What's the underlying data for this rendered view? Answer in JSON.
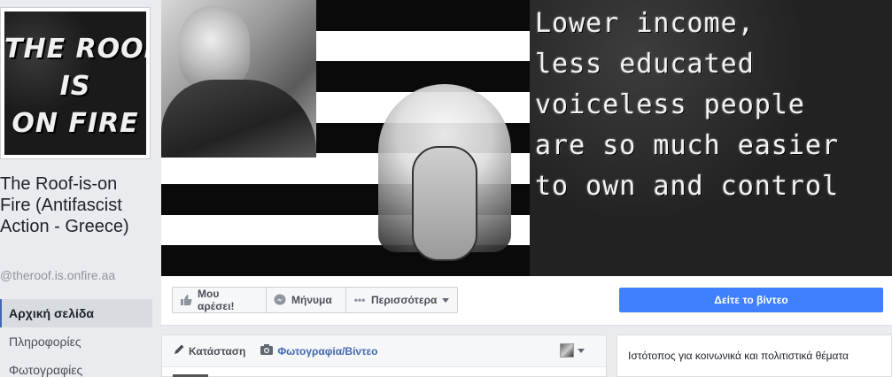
{
  "page": {
    "name": "The Roof-is-on Fire (Antifascist Action - Greece)",
    "handle": "@theroof.is.onfire.aa",
    "profile_logo_text": "THE ROOF\nIS\nON FIRE"
  },
  "nav": {
    "items": [
      {
        "label": "Αρχική σελίδα",
        "active": true
      },
      {
        "label": "Πληροφορίες",
        "active": false
      },
      {
        "label": "Φωτογραφίες",
        "active": false
      }
    ]
  },
  "cover": {
    "quote": "Lower income,\nless educated\nvoiceless people\nare so much easier\nto own and control",
    "flag_colors": [
      "#ffffff",
      "#0a0a0a"
    ]
  },
  "actions": {
    "like_label": "Μου αρέσει!",
    "message_label": "Μήνυμα",
    "more_label": "Περισσότερα",
    "video_label": "Δείτε το βίντεο",
    "like_icon": "thumbs-up-icon",
    "message_icon": "messenger-icon",
    "more_icon": "ellipsis-icon"
  },
  "composer": {
    "status_label": "Κατάσταση",
    "photo_label": "Φωτογραφία/Βίντεο",
    "status_icon": "pencil-icon",
    "photo_icon": "camera-icon"
  },
  "about": {
    "description": "Ιστότοπος για κοινωνικά και πολιτιστικά θέματα"
  },
  "colors": {
    "accent": "#4267b2",
    "primary_button": "#4080ff",
    "background": "#e9ebee"
  }
}
